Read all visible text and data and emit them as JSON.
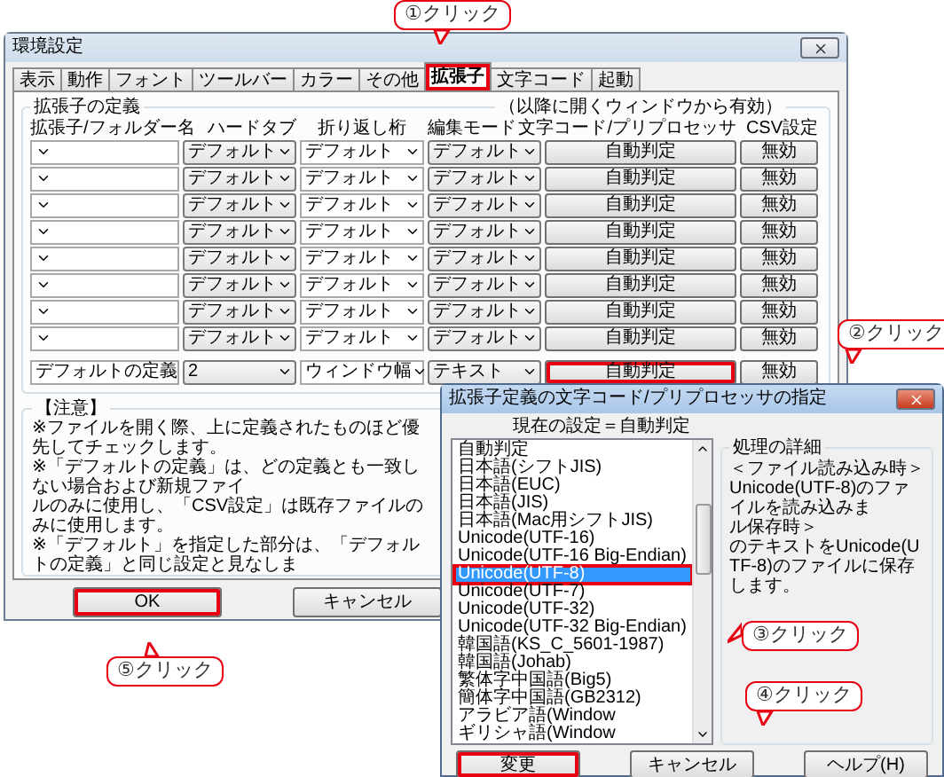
{
  "main_window": {
    "title": "環境設定",
    "tabs": [
      {
        "label": "表示",
        "selected": false,
        "highlighted": false
      },
      {
        "label": "動作",
        "selected": false,
        "highlighted": false
      },
      {
        "label": "フォント",
        "selected": false,
        "highlighted": false
      },
      {
        "label": "ツールバー",
        "selected": false,
        "highlighted": false
      },
      {
        "label": "カラー",
        "selected": false,
        "highlighted": false
      },
      {
        "label": "その他",
        "selected": false,
        "highlighted": false
      },
      {
        "label": "拡張子",
        "selected": true,
        "highlighted": true
      },
      {
        "label": "文字コード",
        "selected": false,
        "highlighted": false
      },
      {
        "label": "起動",
        "selected": false,
        "highlighted": false
      }
    ],
    "group_title": "拡張子の定義",
    "group_note": "（以降に開くウィンドウから有効）",
    "columns": [
      "拡張子/フォルダー名",
      "ハードタブ",
      "折り返し桁",
      "編集モード",
      "文字コード/プリプロセッサ",
      "CSV設定"
    ],
    "rows": [
      {
        "hard_tab": "デフォルト",
        "wrap": "デフォルト",
        "mode": "デフォルト",
        "encoding": "自動判定",
        "csv": "無効",
        "highlighted": false
      },
      {
        "hard_tab": "デフォルト",
        "wrap": "デフォルト",
        "mode": "デフォルト",
        "encoding": "自動判定",
        "csv": "無効",
        "highlighted": false
      },
      {
        "hard_tab": "デフォルト",
        "wrap": "デフォルト",
        "mode": "デフォルト",
        "encoding": "自動判定",
        "csv": "無効",
        "highlighted": false
      },
      {
        "hard_tab": "デフォルト",
        "wrap": "デフォルト",
        "mode": "デフォルト",
        "encoding": "自動判定",
        "csv": "無効",
        "highlighted": false
      },
      {
        "hard_tab": "デフォルト",
        "wrap": "デフォルト",
        "mode": "デフォルト",
        "encoding": "自動判定",
        "csv": "無効",
        "highlighted": false
      },
      {
        "hard_tab": "デフォルト",
        "wrap": "デフォルト",
        "mode": "デフォルト",
        "encoding": "自動判定",
        "csv": "無効",
        "highlighted": false
      },
      {
        "hard_tab": "デフォルト",
        "wrap": "デフォルト",
        "mode": "デフォルト",
        "encoding": "自動判定",
        "csv": "無効",
        "highlighted": false
      },
      {
        "hard_tab": "デフォルト",
        "wrap": "デフォルト",
        "mode": "デフォルト",
        "encoding": "自動判定",
        "csv": "無効",
        "highlighted": false
      }
    ],
    "default_row": {
      "name": "デフォルトの定義",
      "hard_tab": "2",
      "wrap": "ウィンドウ幅",
      "mode": "テキスト",
      "encoding": "自動判定",
      "csv": "無効",
      "highlighted": true
    },
    "notes": {
      "title": "【注意】",
      "lines": [
        "※ファイルを開く際、上に定義されたものほど優先してチェックします。",
        "※「デフォルトの定義」は、どの定義とも一致しない場合および新規ファイ",
        "ルのみに使用し、「CSV設定」は既存ファイルのみに使用します。",
        "※「デフォルト」を指定した部分は、「デフォルトの定義」と同じ設定と見なしま"
      ]
    },
    "buttons": [
      {
        "label": "OK",
        "highlighted": true
      },
      {
        "label": "キャンセル",
        "highlighted": false
      }
    ]
  },
  "encoding_dialog": {
    "title": "拡張子定義の文字コード/プリプロセッサの指定",
    "current": "現在の設定＝自動判定",
    "items": [
      {
        "label": "自動判定",
        "selected": false,
        "highlighted": false
      },
      {
        "label": "日本語(シフトJIS)",
        "selected": false,
        "highlighted": false
      },
      {
        "label": "日本語(EUC)",
        "selected": false,
        "highlighted": false
      },
      {
        "label": "日本語(JIS)",
        "selected": false,
        "highlighted": false
      },
      {
        "label": "日本語(Mac用シフトJIS)",
        "selected": false,
        "highlighted": false
      },
      {
        "label": "Unicode(UTF-16)",
        "selected": false,
        "highlighted": false
      },
      {
        "label": "Unicode(UTF-16 Big-Endian)",
        "selected": false,
        "highlighted": false
      },
      {
        "label": "Unicode(UTF-8)",
        "selected": true,
        "highlighted": true
      },
      {
        "label": "Unicode(UTF-7)",
        "selected": false,
        "highlighted": false
      },
      {
        "label": "Unicode(UTF-32)",
        "selected": false,
        "highlighted": false
      },
      {
        "label": "Unicode(UTF-32 Big-Endian)",
        "selected": false,
        "highlighted": false
      },
      {
        "label": "韓国語(KS_C_5601-1987)",
        "selected": false,
        "highlighted": false
      },
      {
        "label": "韓国語(Johab)",
        "selected": false,
        "highlighted": false
      },
      {
        "label": "繁体字中国語(Big5)",
        "selected": false,
        "highlighted": false
      },
      {
        "label": "簡体字中国語(GB2312)",
        "selected": false,
        "highlighted": false
      },
      {
        "label": "アラビア語(Window",
        "selected": false,
        "highlighted": false
      },
      {
        "label": "ギリシャ語(Window",
        "selected": false,
        "highlighted": false
      }
    ],
    "details": {
      "title": "処理の詳細",
      "lines": [
        "＜ファイル読み込み時＞",
        "Unicode(UTF-8)のファイルを読み込みま",
        "ル保存時＞",
        "のテキストをUnicode(UTF-8)のファイルに保存します。"
      ]
    },
    "buttons": [
      {
        "label": "変更",
        "highlighted": true
      },
      {
        "label": "キャンセル",
        "highlighted": false
      },
      {
        "label": "ヘルプ(H)",
        "highlighted": false
      }
    ]
  },
  "callouts": [
    {
      "label": "①クリック"
    },
    {
      "label": "②クリック"
    },
    {
      "label": "③クリック"
    },
    {
      "label": "④クリック"
    },
    {
      "label": "⑤クリック"
    }
  ]
}
